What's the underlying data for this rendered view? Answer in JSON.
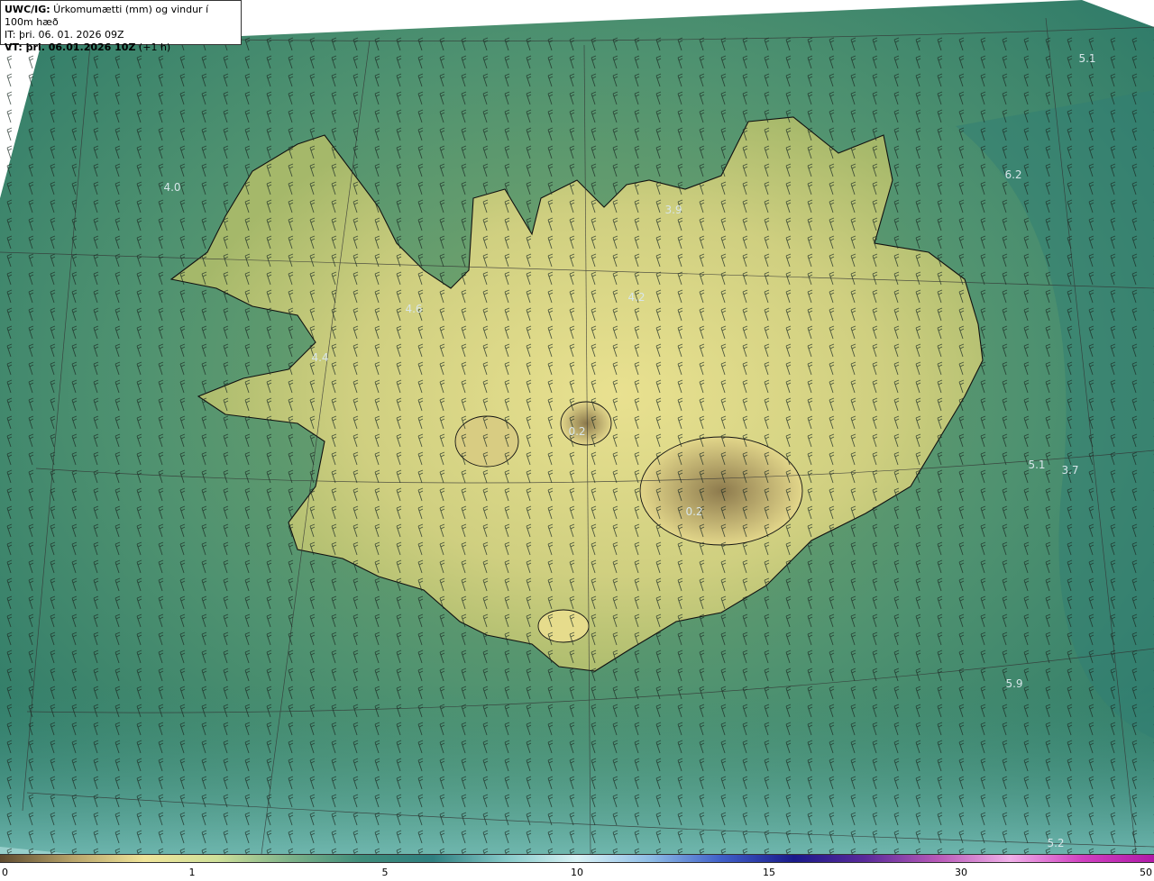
{
  "header": {
    "line1_bold": "UWC/IG:",
    "line1_text": " Úrkomumætti (mm) og vindur í 100m hæð",
    "line2": "IT: þri. 06. 01. 2026 09Z",
    "line3_bold": "VT: þri. 06.01.2026 10Z",
    "line3_text": " (+1 h)"
  },
  "map": {
    "value_labels": [
      "5.1",
      "6.2",
      "4.0",
      "3.9",
      "4.6",
      "4.2",
      "4.4",
      "0.2",
      "0.2",
      "5.1",
      "3.7",
      "5.9",
      "5.2"
    ]
  },
  "colorbar": {
    "ticks": [
      "0",
      "1",
      "5",
      "10",
      "15",
      "30",
      "50"
    ],
    "tick_values": [
      0,
      1,
      5,
      10,
      15,
      30,
      50
    ],
    "colors": [
      "#5e4a2e",
      "#b8a46a",
      "#f0e59a",
      "#cfe09a",
      "#7fb38a",
      "#3f8c7a",
      "#2f7f80",
      "#86c9c8",
      "#d9f2f5",
      "#8fbde6",
      "#3f5fc8",
      "#1a1a8a",
      "#5a2a9a",
      "#b85ab8",
      "#f0b0e8",
      "#d040c0",
      "#b01aa8"
    ]
  },
  "colors": {
    "sea": "#2f7f6c",
    "land_low": "#9cb56a",
    "land_high": "#e8df8c",
    "glacier": "#8e7a4e",
    "coast_line": "#111111",
    "grid_line": "#333333"
  }
}
